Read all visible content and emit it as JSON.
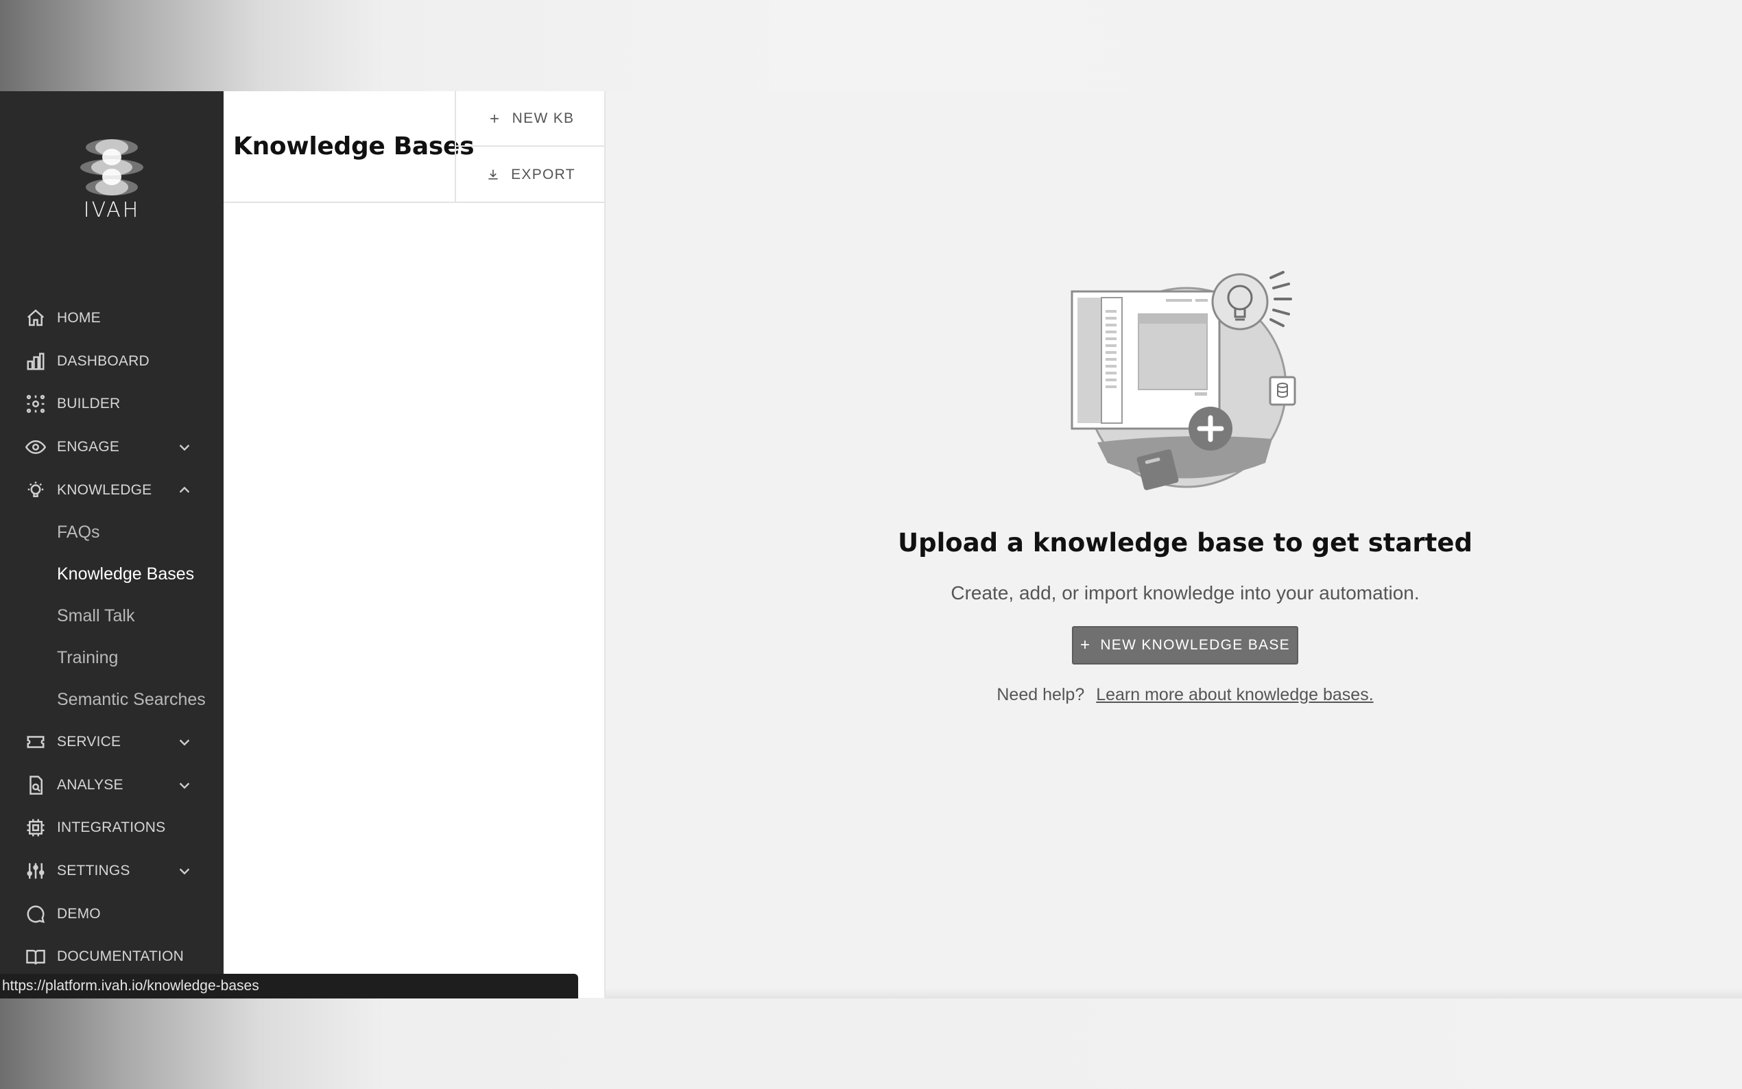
{
  "app": {
    "logo_text": "IVAH"
  },
  "sidebar": {
    "items": [
      {
        "label": "HOME",
        "icon": "home-icon"
      },
      {
        "label": "DASHBOARD",
        "icon": "chart-icon"
      },
      {
        "label": "BUILDER",
        "icon": "builder-icon"
      },
      {
        "label": "ENGAGE",
        "icon": "eye-icon",
        "expandable": true
      },
      {
        "label": "KNOWLEDGE",
        "icon": "lightbulb-icon",
        "expanded": true,
        "children": [
          "FAQs",
          "Knowledge Bases",
          "Small Talk",
          "Training",
          "Semantic Searches"
        ]
      },
      {
        "label": "SERVICE",
        "icon": "ticket-icon",
        "expandable": true
      },
      {
        "label": "ANALYSE",
        "icon": "analyse-icon",
        "expandable": true
      },
      {
        "label": "INTEGRATIONS",
        "icon": "chip-icon"
      },
      {
        "label": "SETTINGS",
        "icon": "sliders-icon",
        "expandable": true
      },
      {
        "label": "DEMO",
        "icon": "chat-icon"
      },
      {
        "label": "DOCUMENTATION",
        "icon": "book-icon"
      }
    ],
    "active_child": "Knowledge Bases"
  },
  "kb_panel": {
    "title": "Knowledge Bases",
    "new_kb_label": "NEW KB",
    "export_label": "EXPORT"
  },
  "empty_state": {
    "title": "Upload a knowledge base to get started",
    "subtitle": "Create, add, or import knowledge into your automation.",
    "cta_label": "NEW KNOWLEDGE BASE",
    "help_prefix": "Need help?",
    "help_link": "Learn more about knowledge bases."
  },
  "status_bar": {
    "url": "https://platform.ivah.io/knowledge-bases"
  }
}
